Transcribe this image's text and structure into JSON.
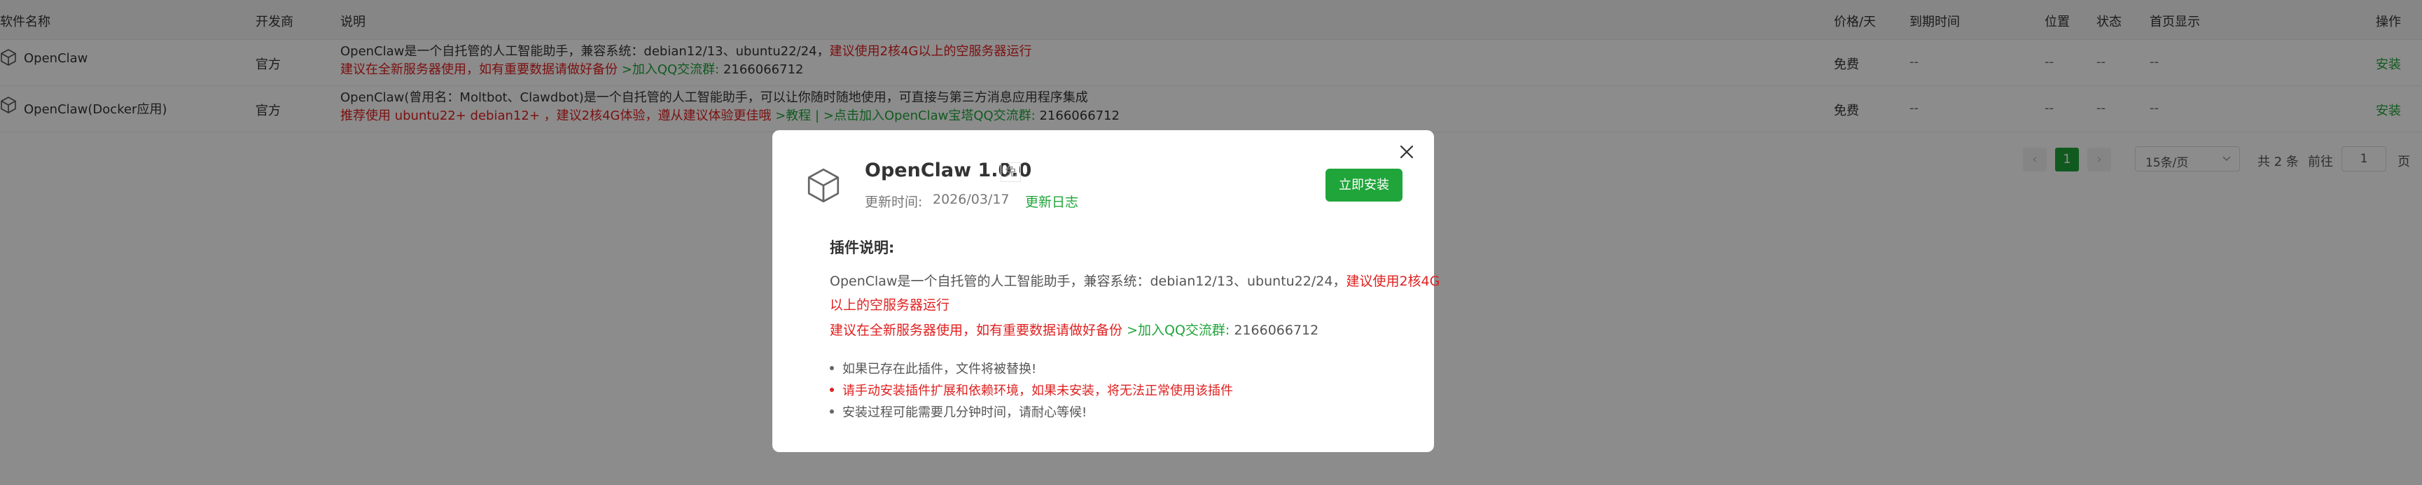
{
  "table": {
    "headers": {
      "name": "软件名称",
      "developer": "开发商",
      "description": "说明",
      "price": "价格/天",
      "expire": "到期时间",
      "location": "位置",
      "status": "状态",
      "homepage": "首页显示",
      "actions": "操作"
    },
    "rows": [
      {
        "name": "OpenClaw",
        "developer": "官方",
        "desc_line1_a": "OpenClaw是一个自托管的人工智能助手，兼容系统：debian12/13、ubuntu22/24，",
        "desc_line1_b": "建议使用2核4G以上的空服务器运行",
        "desc_line2_a": "建议在全新服务器使用，如有重要数据请做好备份",
        "desc_line2_b": ">加入QQ交流群:",
        "desc_line2_c": "2166066712",
        "price": "免费",
        "expire": "--",
        "location": "--",
        "status": "--",
        "homepage": "--",
        "action": "安装"
      },
      {
        "name": "OpenClaw(Docker应用)",
        "developer": "官方",
        "desc_line1_a": "OpenClaw(曾用名：Moltbot、Clawdbot)是一个自托管的人工智能助手，可以让你随时随地使用，可直接与第三方消息应用程序集成",
        "desc_line2_a": "推荐使用 ubuntu22+ debian12+ ，建议2核4G体验，遵从建议体验更佳哦",
        "desc_line2_b": ">教程",
        "desc_line2_sep": "|",
        "desc_line2_c": ">点击加入OpenClaw宝塔QQ交流群:",
        "desc_line2_d": "2166066712",
        "price": "免费",
        "expire": "--",
        "location": "--",
        "status": "--",
        "homepage": "--",
        "action": "安装"
      }
    ]
  },
  "pagination": {
    "prev": "‹",
    "current": "1",
    "next": "›",
    "page_size": "15条/页",
    "total": "共 2 条",
    "goto_label": "前往",
    "goto_value": "1",
    "page_suffix": "页"
  },
  "modal": {
    "title": "OpenClaw 1.0.0",
    "free_badge": "免",
    "updated_label": "更新时间:",
    "updated_date": "2026/03/17",
    "changelog_link": "更新日志",
    "install_button": "立即安装",
    "close_icon": "close-icon",
    "section_title": "插件说明:",
    "desc_line1_a": "OpenClaw是一个自托管的人工智能助手，兼容系统：debian12/13、ubuntu22/24，",
    "desc_line1_b": "建议使用2核4G",
    "desc_line2": "以上的空服务器运行",
    "desc_line3_a": "建议在全新服务器使用，如有重要数据请做好备份",
    "desc_line3_b": ">加入QQ交流群:",
    "desc_line3_c": "2166066712",
    "notes": [
      "如果已存在此插件，文件将被替换!",
      "请手动安装插件扩展和依赖环境，如果未安装，将无法正常使用该插件",
      "安装过程可能需要几分钟时间，请耐心等候!"
    ]
  },
  "colors": {
    "accent_green": "#20a53a",
    "warning_red": "#e02020",
    "overlay": "rgba(0,0,0,0.45)"
  }
}
